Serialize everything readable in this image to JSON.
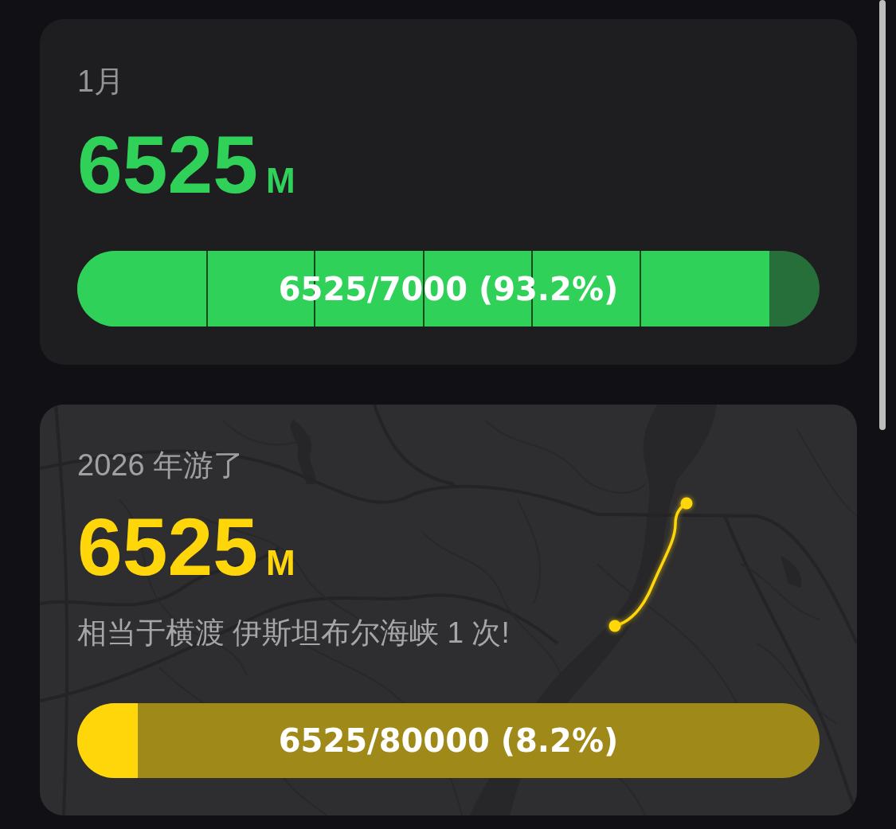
{
  "cards": [
    {
      "kind": "plain",
      "color": "#30d158",
      "period_label": "1月",
      "distance": {
        "value": "6525",
        "unit": "M"
      },
      "progress": {
        "level": 0.932,
        "reading": "6525/7000 (93.2%)"
      }
    },
    {
      "kind": "map",
      "color": "#ffd60a",
      "period_label": "2026 年游了",
      "distance": {
        "value": "6525",
        "unit": "M"
      },
      "comparison": "相当于横渡 伊斯坦布尔海峡 1 次!",
      "progress": {
        "level": 0.082,
        "reading": "6525/80000 (8.2%)"
      }
    }
  ]
}
